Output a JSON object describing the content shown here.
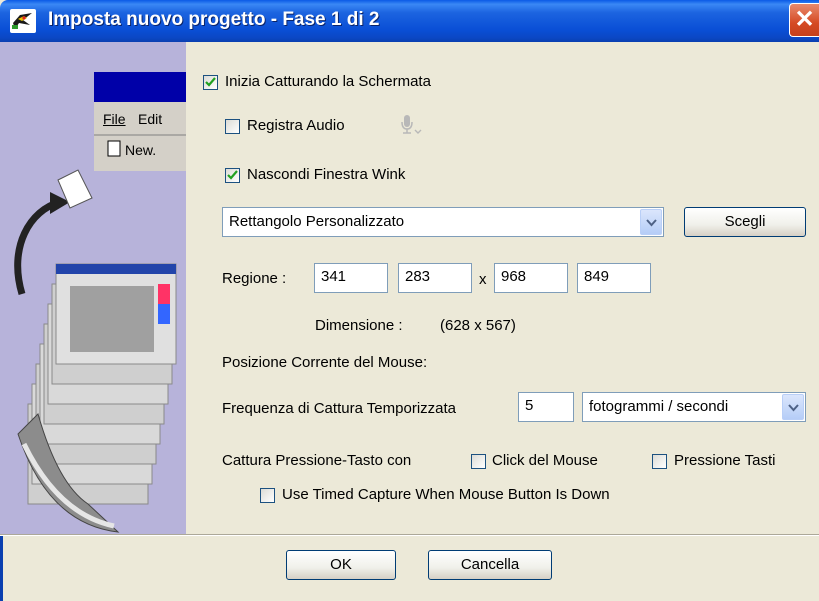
{
  "window": {
    "title": "Imposta nuovo progetto - Fase 1 di 2",
    "close_label": "✕"
  },
  "sidepanel": {
    "menu_file": "File",
    "menu_edit": "Edit",
    "menu_new": "New."
  },
  "options": {
    "start_capture": {
      "label": "Inizia Catturando la Schermata",
      "checked": true
    },
    "record_audio": {
      "label": "Registra Audio",
      "checked": false
    },
    "hide_window": {
      "label": "Nascondi Finestra Wink",
      "checked": true
    }
  },
  "region_type": {
    "selected": "Rettangolo Personalizzato",
    "choose_label": "Scegli"
  },
  "region": {
    "label": "Regione :",
    "x1": "341",
    "y1": "283",
    "separator": "x",
    "x2": "968",
    "y2": "849"
  },
  "dimension": {
    "label": "Dimensione :",
    "value": "(628 x 567)"
  },
  "mouse_position": {
    "label": "Posizione Corrente del Mouse:"
  },
  "capture_rate": {
    "label": "Frequenza di Cattura Temporizzata",
    "value": "5",
    "unit": "fotogrammi / secondi"
  },
  "keypress": {
    "label": "Cattura Pressione-Tasto con",
    "mouse_click": {
      "label": "Click del Mouse",
      "checked": false
    },
    "key_press": {
      "label": "Pressione Tasti",
      "checked": false
    }
  },
  "timed_capture": {
    "label": "Use Timed Capture When Mouse Button Is Down",
    "checked": false
  },
  "footer": {
    "ok_label": "OK",
    "cancel_label": "Cancella"
  },
  "colors": {
    "titlebar": "#0a4fd6",
    "sidepanel": "#b7b3da",
    "dialog_bg": "#ece9d8",
    "check": "#21a121"
  }
}
